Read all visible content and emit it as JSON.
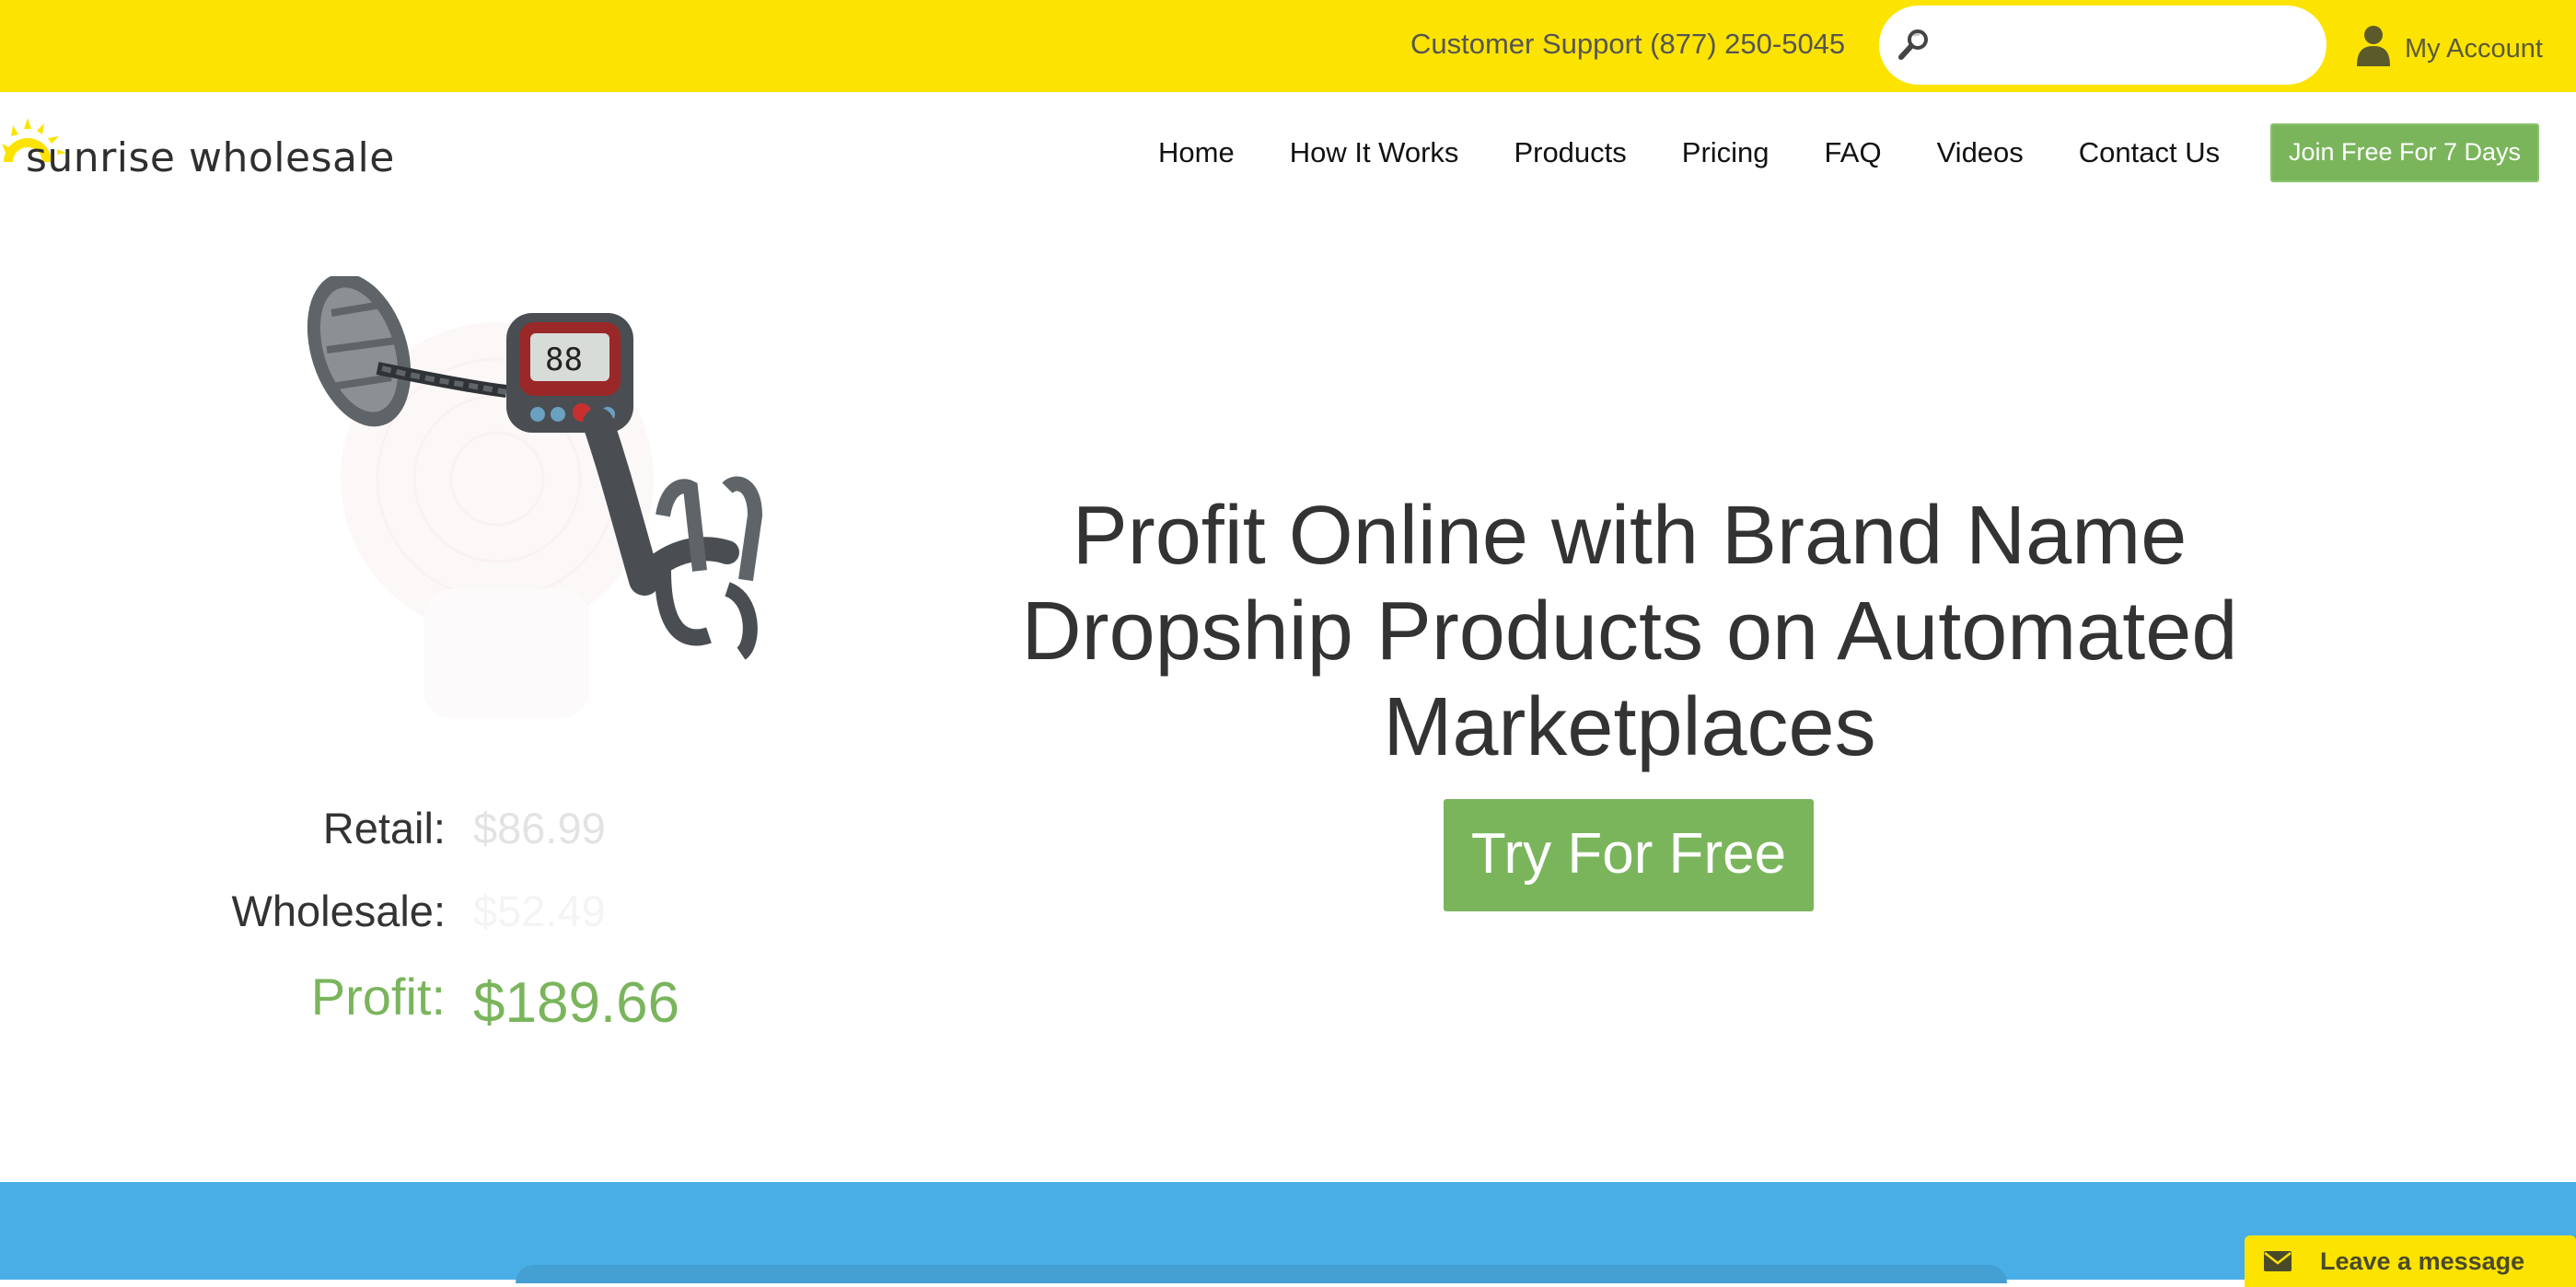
{
  "topbar": {
    "support_text": "Customer Support (877) 250-5045",
    "search_placeholder": "",
    "account_label": "My Account",
    "background_color": "#fde300"
  },
  "logo": {
    "text": "sunrise wholesale",
    "sun_color": "#fde300"
  },
  "nav": {
    "items": [
      {
        "label": "Home"
      },
      {
        "label": "How It Works"
      },
      {
        "label": "Products"
      },
      {
        "label": "Pricing"
      },
      {
        "label": "FAQ"
      },
      {
        "label": "Videos"
      },
      {
        "label": "Contact Us"
      }
    ],
    "join_button": "Join Free For 7 Days"
  },
  "hero": {
    "product_image": "metal-detector",
    "prices": {
      "retail_label": "Retail:",
      "retail_value": "$86.99",
      "wholesale_label": "Wholesale:",
      "wholesale_value": "$52.49",
      "profit_label": "Profit:",
      "profit_value": "$189.66"
    },
    "headline": "Profit Online with Brand Name Dropship Products on Automated Marketplaces",
    "cta_button": "Try For Free",
    "accent_color": "#7ab55c"
  },
  "chat_widget": {
    "label": "Leave a message",
    "icon": "envelope-icon"
  },
  "band_color": "#4aaee6"
}
